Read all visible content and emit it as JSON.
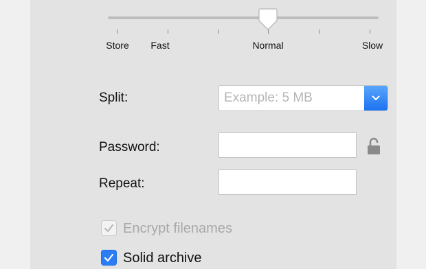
{
  "compression": {
    "levels": [
      "Store",
      "Fast",
      "Normal",
      "Slow"
    ],
    "selected": "Normal"
  },
  "split": {
    "label": "Split:",
    "placeholder": "Example: 5 MB",
    "value": ""
  },
  "password": {
    "label": "Password:",
    "value": "",
    "lock_state": "unlocked"
  },
  "repeat": {
    "label": "Repeat:",
    "value": ""
  },
  "options": {
    "encrypt_filenames": {
      "label": "Encrypt filenames",
      "checked": true,
      "enabled": false
    },
    "solid_archive": {
      "label": "Solid archive",
      "checked": true,
      "enabled": true
    }
  },
  "colors": {
    "accent": "#2a7df5",
    "panel_bg": "#e3e3e3",
    "disabled_text": "#a8a8a8"
  }
}
